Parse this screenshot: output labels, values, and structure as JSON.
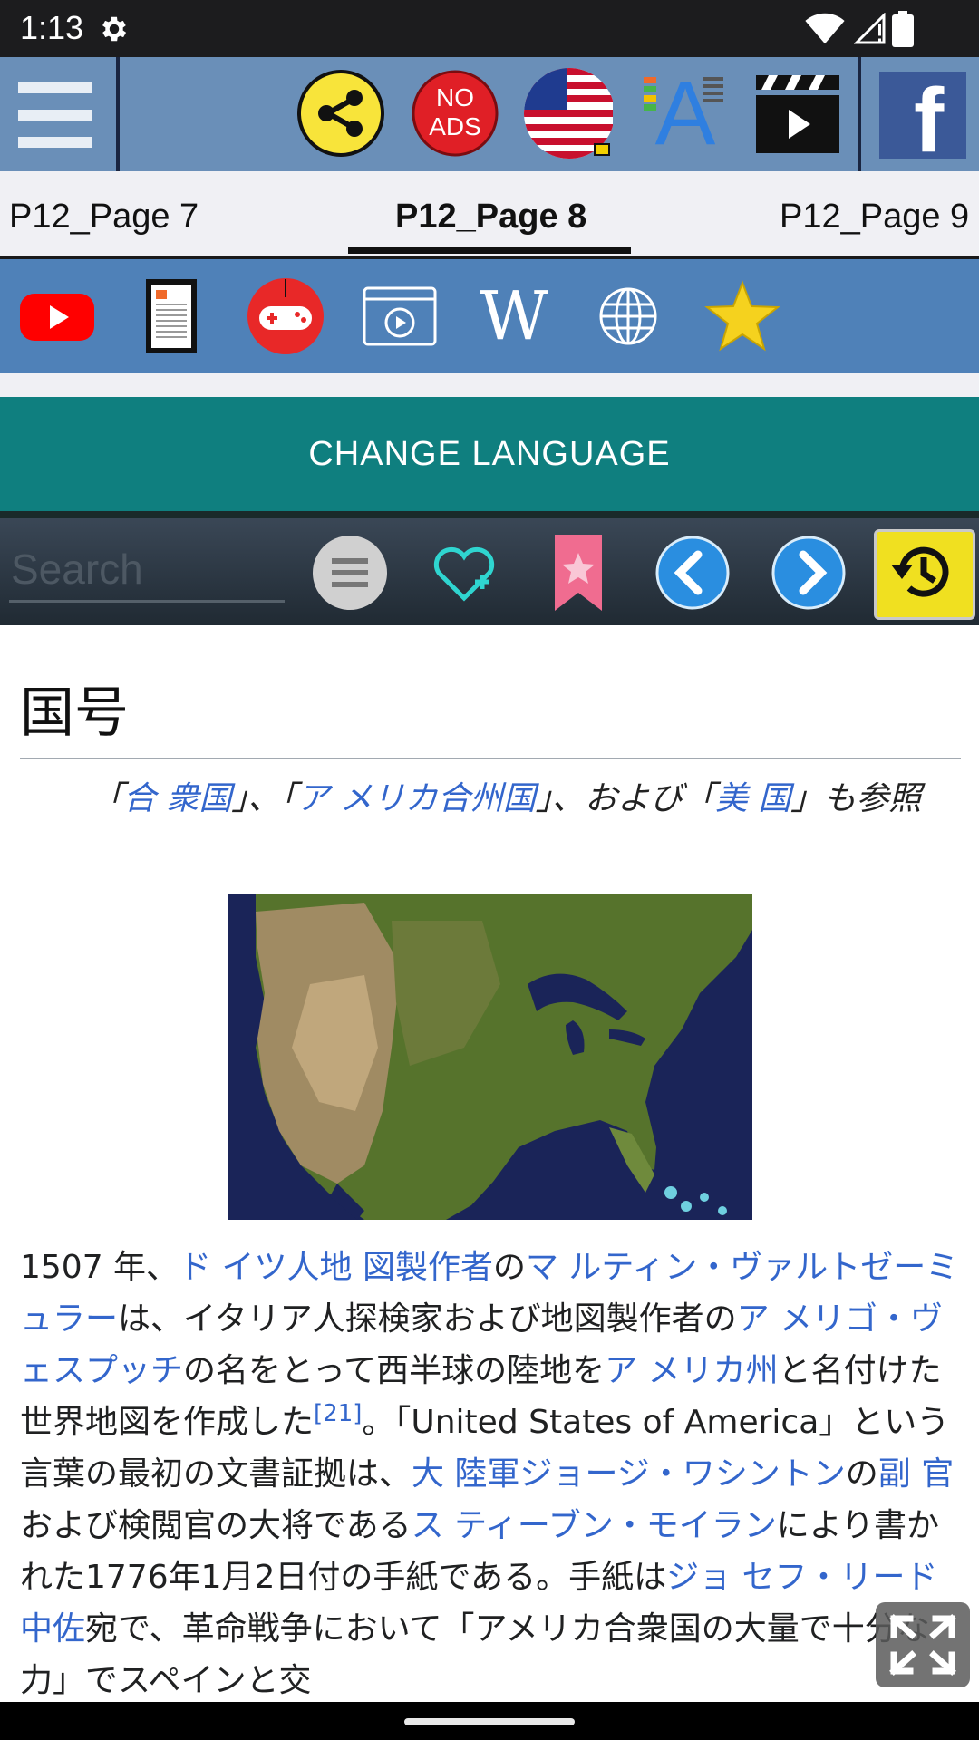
{
  "status_bar": {
    "time": "1:13",
    "icons": [
      "gear-icon",
      "wifi-icon",
      "signal-icon",
      "battery-icon"
    ]
  },
  "toolbar": {
    "icons": [
      "hamburger-menu-icon",
      "share-icon",
      "no-ads-icon",
      "us-flag-icon",
      "font-size-icon",
      "video-clapper-icon",
      "facebook-icon"
    ],
    "no_ads_line1": "NO",
    "no_ads_line2": "ADS",
    "font_letter": "A",
    "facebook_letter": "f"
  },
  "tabs": [
    {
      "label": "P12_Page 7"
    },
    {
      "label": "P12_Page 8",
      "active": true
    },
    {
      "label": "P12_Page 9"
    }
  ],
  "quickbar": {
    "icons": [
      "youtube-icon",
      "ebook-icon",
      "gamepad-icon",
      "video-player-icon",
      "wikipedia-icon",
      "globe-icon",
      "star-icon"
    ],
    "wikipedia_letter": "W"
  },
  "change_language": {
    "label": "CHANGE LANGUAGE"
  },
  "search": {
    "placeholder": "Search",
    "icons": [
      "list-menu-icon",
      "heart-plus-icon",
      "bookmark-icon",
      "back-arrow-icon",
      "forward-arrow-icon",
      "history-icon"
    ]
  },
  "article": {
    "heading": "国号",
    "hatnote": {
      "p1": "「",
      "l1": "合 衆国",
      "p2": "」、「",
      "l2": "ア メリカ合州国",
      "p3": "」、および「",
      "l3": "美 国",
      "p4": "」も参照"
    },
    "image": "north-america-satellite-map",
    "body": {
      "t1": "1507 年、",
      "l1": "ド イツ人地 図製作者",
      "t2": "の",
      "l2": "マ ルティン・ヴァルトゼーミュラー",
      "t3": "は、イタリア人探検家および地図製作者の",
      "l3": "ア メリゴ・ヴェスプッチ",
      "t4": "の名をとって西半球の陸地を",
      "l4": "ア メリカ州",
      "t5": "と名付けた世界地図を作成した",
      "sup1": "[21]",
      "t6": "。「United States of America」という言葉の最初の文書証拠は、",
      "l5": "大 陸軍ジョージ・ワシントン",
      "t7": "の",
      "l6": "副 官",
      "t8": "および検閲官の大将である",
      "l7": "ス ティーブン・モイラン",
      "t9": "により書かれた1776年1月2日付の手紙である。手紙は",
      "l8": "ジョ セフ・リード中佐",
      "t10": "宛で、革命戦争において「アメリカ合衆国の大量で十分な力」でスペインと交"
    }
  },
  "fullscreen_button": {
    "icon": "fullscreen-expand-icon"
  },
  "colors": {
    "toolbar": "#6a8fb8",
    "quickbar": "#4f81b8",
    "change_language": "#0f7f7f",
    "link": "#3366cc",
    "history_box": "#f0e020"
  }
}
